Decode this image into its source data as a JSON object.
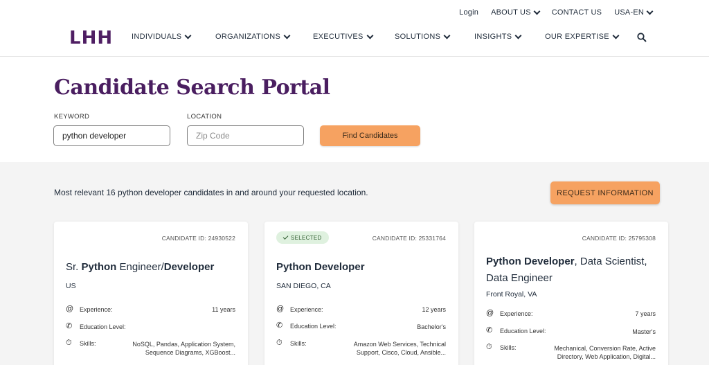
{
  "header": {
    "logo": "LHH",
    "util_nav": [
      {
        "label": "Login",
        "has_chevron": false
      },
      {
        "label": "ABOUT US",
        "has_chevron": true
      },
      {
        "label": "CONTACT US",
        "has_chevron": false
      },
      {
        "label": "USA-EN",
        "has_chevron": true
      }
    ],
    "main_nav": [
      {
        "label": "INDIVIDUALS"
      },
      {
        "label": "ORGANIZATIONS"
      },
      {
        "label": "EXECUTIVES"
      },
      {
        "label": "SOLUTIONS"
      },
      {
        "label": "INSIGHTS"
      },
      {
        "label": "OUR EXPERTISE"
      }
    ],
    "search_icon": "search-icon"
  },
  "search": {
    "title": "Candidate Search Portal",
    "keyword_label": "KEYWORD",
    "keyword_value": "python developer",
    "location_label": "LOCATION",
    "location_placeholder": "Zip Code",
    "find_button": "Find Candidates"
  },
  "results": {
    "summary": "Most relevant 16 python developer candidates in and around your requested location.",
    "request_button": "REQUEST INFORMATION",
    "labels": {
      "experience": "Experience:",
      "education": "Education Level:",
      "skills": "Skills:"
    },
    "cards": [
      {
        "candidate_id": "CANDIDATE ID: 24930522",
        "selected": false,
        "title_parts": [
          {
            "text": "Sr. ",
            "bold": false
          },
          {
            "text": "Python",
            "bold": true
          },
          {
            "text": " Engineer/",
            "bold": false
          },
          {
            "text": "Developer",
            "bold": true
          }
        ],
        "location": "US",
        "experience": "11 years",
        "education": "",
        "skills": "NoSQL, Pandas, Application System, Sequence Diagrams, XGBoost..."
      },
      {
        "candidate_id": "CANDIDATE ID: 25331764",
        "selected": true,
        "badge": "SELECTED",
        "title_parts": [
          {
            "text": "Python Developer",
            "bold": true
          }
        ],
        "location": "SAN DIEGO, CA",
        "experience": "12 years",
        "education": "Bachelor's",
        "skills": "Amazon Web Services, Technical Support, Cisco, Cloud, Ansible..."
      },
      {
        "candidate_id": "CANDIDATE ID: 25795308",
        "selected": false,
        "title_parts": [
          {
            "text": "Python Developer",
            "bold": true
          },
          {
            "text": ", Data Scientist, Data Engineer",
            "bold": false
          }
        ],
        "location": "Front Royal, VA",
        "experience": "7 years",
        "education": "Master's",
        "skills": "Mechanical, Conversion Rate, Active Directory, Web Application, Digital..."
      }
    ]
  },
  "icons": {
    "experience": "at-icon",
    "education": "phone-icon",
    "skills": "stopwatch-icon",
    "badge": "check-icon"
  }
}
